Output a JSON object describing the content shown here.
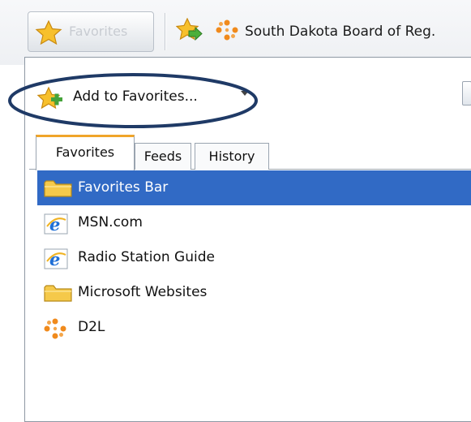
{
  "toolbar": {
    "favorites_button": "Favorites",
    "bar_link": "South Dakota Board of Reg."
  },
  "panel": {
    "add_to_favorites": "Add to Favorites..."
  },
  "tabs": [
    {
      "label": "Favorites",
      "active": true
    },
    {
      "label": "Feeds",
      "active": false
    },
    {
      "label": "History",
      "active": false
    }
  ],
  "items": [
    {
      "label": "Favorites Bar",
      "icon": "folder-icon",
      "selected": true
    },
    {
      "label": "MSN.com",
      "icon": "ie-icon",
      "selected": false
    },
    {
      "label": "Radio Station Guide",
      "icon": "ie-icon",
      "selected": false
    },
    {
      "label": "Microsoft Websites",
      "icon": "folder-icon",
      "selected": false
    },
    {
      "label": "D2L",
      "icon": "d2l-icon",
      "selected": false
    }
  ],
  "colors": {
    "selection": "#316ac5",
    "tab_accent": "#f0a52a",
    "annotation_ellipse": "#1f3a66"
  }
}
